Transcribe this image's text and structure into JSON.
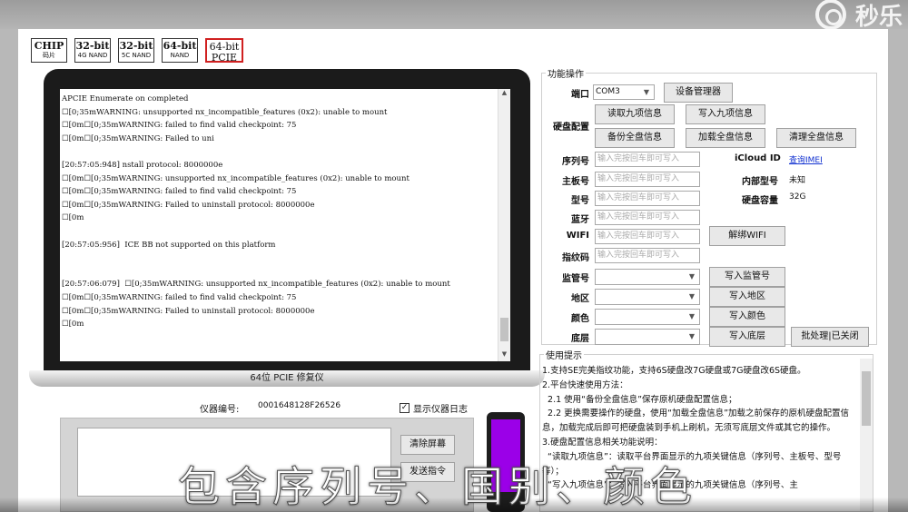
{
  "watermark": {
    "text": "秒乐"
  },
  "chips": [
    {
      "top": "CHIP",
      "bottom": "码片"
    },
    {
      "top": "32-bit",
      "bottom": "4G NAND"
    },
    {
      "top": "32-bit",
      "bottom": "5C NAND"
    },
    {
      "top": "64-bit",
      "bottom": "NAND"
    },
    {
      "top": "64-bit",
      "bottom": "PCIE"
    }
  ],
  "terminal": {
    "log": "APCIE Enumerate on completed\n☐[0;35mWARNING: unsupported nx_incompatible_features (0x2): unable to mount\n☐[0m☐[0;35mWARNING: failed to find valid checkpoint: 75\n☐[0m☐[0;35mWARNING: Failed to uni\n\n[20:57:05:948] nstall protocol: 8000000e\n☐[0m☐[0;35mWARNING: unsupported nx_incompatible_features (0x2): unable to mount\n☐[0m☐[0;35mWARNING: failed to find valid checkpoint: 75\n☐[0m☐[0;35mWARNING: Failed to uninstall protocol: 8000000e\n☐[0m\n\n[20:57:05:956]  ICE BB not supported on this platform\n\n\n[20:57:06:079]  ☐[0;35mWARNING: unsupported nx_incompatible_features (0x2): unable to mount\n☐[0m☐[0;35mWARNING: failed to find valid checkpoint: 75\n☐[0m☐[0;35mWARNING: Failed to uninstall protocol: 8000000e\n☐[0m",
    "laptop_label": "64位 PCIE 修复仪"
  },
  "device": {
    "serial_label": "仪器编号:",
    "serial_value": "0001648128F26526",
    "show_log_label": "显示仪器日志",
    "show_log_checked": "✓"
  },
  "command": {
    "clear_label": "清除屏幕",
    "send_label": "发送指令"
  },
  "functions": {
    "group_title": "功能操作",
    "port_label": "端口",
    "port_value": "COM3",
    "device_manager": "设备管理器",
    "disk_config_label": "硬盘配置",
    "read_nine": "读取九项信息",
    "write_nine": "写入九项信息",
    "backup_all": "备份全盘信息",
    "load_all": "加载全盘信息",
    "clear_all": "清理全盘信息",
    "placeholder": "输入完按回车即可写入",
    "fields": [
      {
        "label": "序列号"
      },
      {
        "label": "主板号"
      },
      {
        "label": "型号"
      },
      {
        "label": "蓝牙"
      },
      {
        "label": "WIFI"
      },
      {
        "label": "指纹码"
      }
    ],
    "icloud_label": "iCloud ID",
    "icloud_link": "查询IMEI",
    "internal_model_label": "内部型号",
    "internal_model_value": "未知",
    "capacity_label": "硬盘容量",
    "capacity_value": "32G",
    "unbind_wifi": "解绑WIFI",
    "selects": [
      {
        "label": "监管号",
        "button": "写入监管号"
      },
      {
        "label": "地区",
        "button": "写入地区"
      },
      {
        "label": "颜色",
        "button": "写入颜色"
      },
      {
        "label": "底层",
        "button": "写入底层"
      }
    ],
    "batch_label": "批处理|已关闭"
  },
  "tips": {
    "title": "使用提示",
    "text": "1.支持SE完美指纹功能，支持6S硬盘改7G硬盘或7G硬盘改6S硬盘。\n2.平台快速使用方法：\n  2.1 使用“备份全盘信息”保存原机硬盘配置信息；\n  2.2 更换需要操作的硬盘，使用“加载全盘信息”加载之前保存的原机硬盘配置信息，加载完成后即可把硬盘装到手机上刷机，无须写底层文件或其它的操作。\n3.硬盘配置信息相关功能说明：\n  “读取九项信息”：读取平台界面显示的九项关键信息（序列号、主板号、型号等）；\n  “写入九项信息”：写入平台界面显示的九项关键信息（序列号、主"
  },
  "subtitle": {
    "text": "包含序列号、国别、颜色"
  }
}
